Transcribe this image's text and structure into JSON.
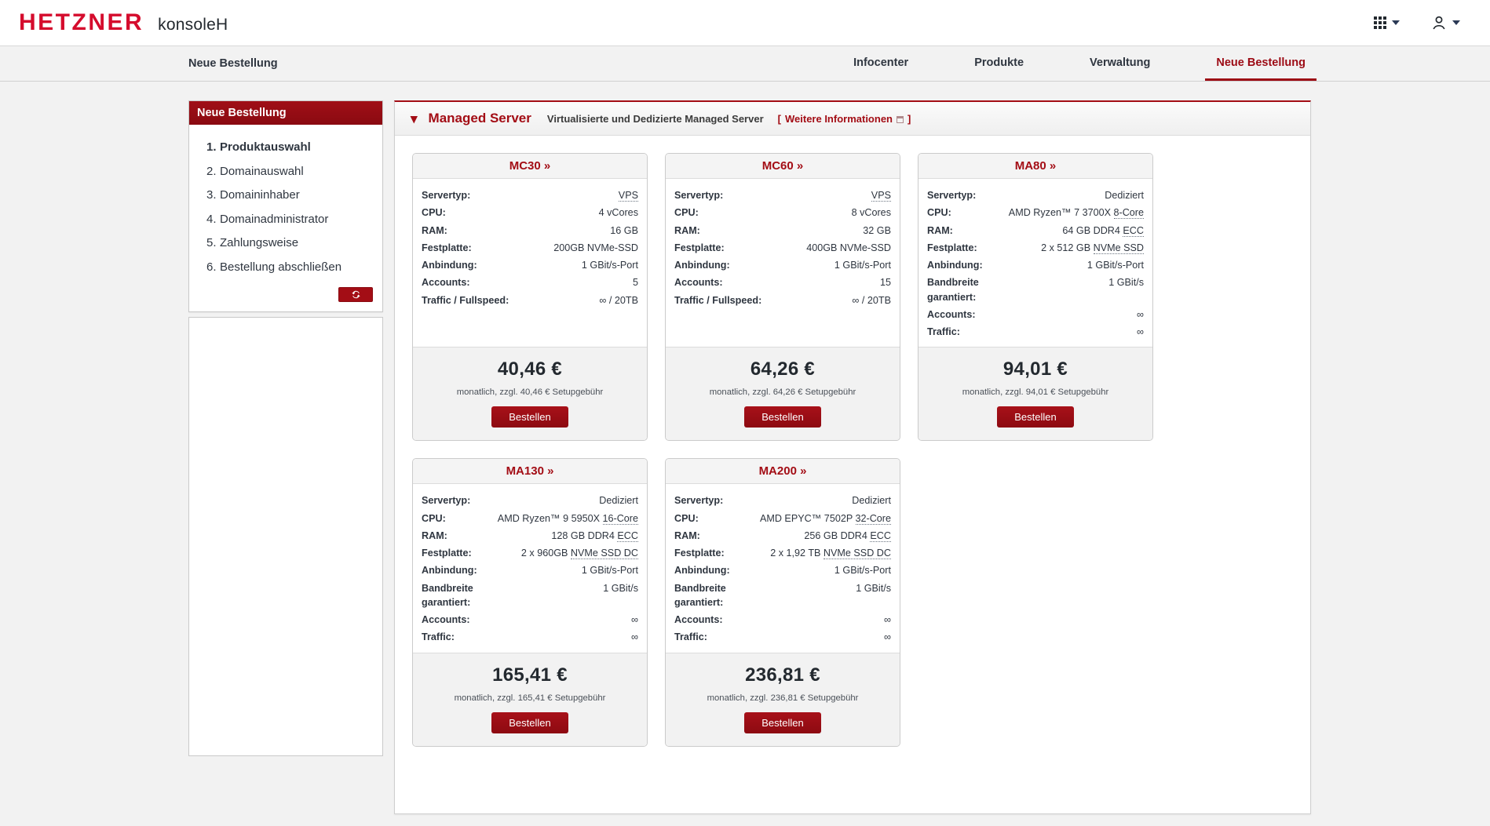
{
  "header": {
    "brand": "HETZNER",
    "app_name": "konsoleH",
    "brand_color": "#d50c2d",
    "grid_menu_icon": "grid-apps-icon",
    "account_icon": "user-account-icon"
  },
  "nav": {
    "page_label": "Neue Bestellung",
    "items": [
      {
        "label": "Infocenter",
        "active": false
      },
      {
        "label": "Produkte",
        "active": false
      },
      {
        "label": "Verwaltung",
        "active": false
      },
      {
        "label": "Neue Bestellung",
        "active": true
      }
    ],
    "active_color": "#9c0a14"
  },
  "sidebar": {
    "title": "Neue Bestellung",
    "steps": [
      {
        "num": "1.",
        "label": "Produktauswahl",
        "current": true
      },
      {
        "num": "2.",
        "label": "Domainauswahl",
        "current": false
      },
      {
        "num": "3.",
        "label": "Domaininhaber",
        "current": false
      },
      {
        "num": "4.",
        "label": "Domainadministrator",
        "current": false
      },
      {
        "num": "5.",
        "label": "Zahlungsweise",
        "current": false
      },
      {
        "num": "6.",
        "label": "Bestellung abschließen",
        "current": false
      }
    ],
    "reload_icon": "refresh-icon"
  },
  "panel": {
    "collapse_icon": "chevron-down-icon",
    "title": "Managed Server",
    "subtitle": "Virtualisierte und Dedizierte Managed Server",
    "link_open": "[",
    "link_label": "Weitere Informationen",
    "link_close": "]",
    "external_icon": "external-link-icon"
  },
  "products": [
    {
      "name": "MC30 »",
      "specs": [
        {
          "label": "Servertyp:",
          "value": "VPS",
          "dotted": true
        },
        {
          "label": "CPU:",
          "value": "4 vCores",
          "dotted": false
        },
        {
          "label": "RAM:",
          "value": "16 GB",
          "dotted": false
        },
        {
          "label": "Festplatte:",
          "value": "200GB NVMe-SSD",
          "dotted": false
        },
        {
          "label": "Anbindung:",
          "value": "1 GBit/s-Port",
          "dotted": false
        },
        {
          "label": "Accounts:",
          "value": "5",
          "dotted": false
        },
        {
          "label": "Traffic / Fullspeed:",
          "value": "∞ / 20TB",
          "dotted": false
        }
      ],
      "price": "40,46 €",
      "price_note": "monatlich, zzgl. 40,46 € Setupgebühr",
      "order_label": "Bestellen"
    },
    {
      "name": "MC60 »",
      "specs": [
        {
          "label": "Servertyp:",
          "value": "VPS",
          "dotted": true
        },
        {
          "label": "CPU:",
          "value": "8 vCores",
          "dotted": false
        },
        {
          "label": "RAM:",
          "value": "32 GB",
          "dotted": false
        },
        {
          "label": "Festplatte:",
          "value": "400GB NVMe-SSD",
          "dotted": false
        },
        {
          "label": "Anbindung:",
          "value": "1 GBit/s-Port",
          "dotted": false
        },
        {
          "label": "Accounts:",
          "value": "15",
          "dotted": false
        },
        {
          "label": "Traffic / Fullspeed:",
          "value": "∞ / 20TB",
          "dotted": false
        }
      ],
      "price": "64,26 €",
      "price_note": "monatlich, zzgl. 64,26 € Setupgebühr",
      "order_label": "Bestellen"
    },
    {
      "name": "MA80 »",
      "specs": [
        {
          "label": "Servertyp:",
          "value": "Dediziert",
          "dotted": false
        },
        {
          "label": "CPU:",
          "value": "AMD Ryzen™ 7 3700X 8-Core",
          "dotted_tail": "8-Core",
          "dotted": false
        },
        {
          "label": "RAM:",
          "value": "64 GB DDR4 ECC",
          "dotted_tail": "ECC",
          "dotted": false
        },
        {
          "label": "Festplatte:",
          "value": "2 x 512 GB NVMe SSD",
          "dotted_tail": "NVMe SSD",
          "dotted": false
        },
        {
          "label": "Anbindung:",
          "value": "1 GBit/s-Port",
          "dotted": false
        },
        {
          "label": "Bandbreite garantiert:",
          "value": "1 GBit/s",
          "dotted": false
        },
        {
          "label": "Accounts:",
          "value": "∞",
          "dotted": false
        },
        {
          "label": "Traffic:",
          "value": "∞",
          "dotted": false
        }
      ],
      "price": "94,01 €",
      "price_note": "monatlich, zzgl. 94,01 € Setupgebühr",
      "order_label": "Bestellen"
    },
    {
      "name": "MA130 »",
      "specs": [
        {
          "label": "Servertyp:",
          "value": "Dediziert",
          "dotted": false
        },
        {
          "label": "CPU:",
          "value": "AMD Ryzen™ 9 5950X 16-Core",
          "dotted_tail": "16-Core",
          "dotted": false
        },
        {
          "label": "RAM:",
          "value": "128 GB DDR4 ECC",
          "dotted_tail": "ECC",
          "dotted": false
        },
        {
          "label": "Festplatte:",
          "value": "2 x 960GB NVMe SSD DC",
          "dotted_tail": "NVMe SSD DC",
          "dotted": false
        },
        {
          "label": "Anbindung:",
          "value": "1 GBit/s-Port",
          "dotted": false
        },
        {
          "label": "Bandbreite garantiert:",
          "value": "1 GBit/s",
          "dotted": false
        },
        {
          "label": "Accounts:",
          "value": "∞",
          "dotted": false
        },
        {
          "label": "Traffic:",
          "value": "∞",
          "dotted": false
        }
      ],
      "price": "165,41 €",
      "price_note": "monatlich, zzgl. 165,41 € Setupgebühr",
      "order_label": "Bestellen"
    },
    {
      "name": "MA200 »",
      "specs": [
        {
          "label": "Servertyp:",
          "value": "Dediziert",
          "dotted": false
        },
        {
          "label": "CPU:",
          "value": "AMD EPYC™ 7502P 32-Core",
          "dotted_tail": "32-Core",
          "dotted": false
        },
        {
          "label": "RAM:",
          "value": "256 GB DDR4 ECC",
          "dotted_tail": "ECC",
          "dotted": false
        },
        {
          "label": "Festplatte:",
          "value": "2 x 1,92 TB NVMe SSD DC",
          "dotted_tail": "NVMe SSD DC",
          "dotted": false
        },
        {
          "label": "Anbindung:",
          "value": "1 GBit/s-Port",
          "dotted": false
        },
        {
          "label": "Bandbreite garantiert:",
          "value": "1 GBit/s",
          "dotted": false
        },
        {
          "label": "Accounts:",
          "value": "∞",
          "dotted": false
        },
        {
          "label": "Traffic:",
          "value": "∞",
          "dotted": false
        }
      ],
      "price": "236,81 €",
      "price_note": "monatlich, zzgl. 236,81 € Setupgebühr",
      "order_label": "Bestellen"
    }
  ]
}
